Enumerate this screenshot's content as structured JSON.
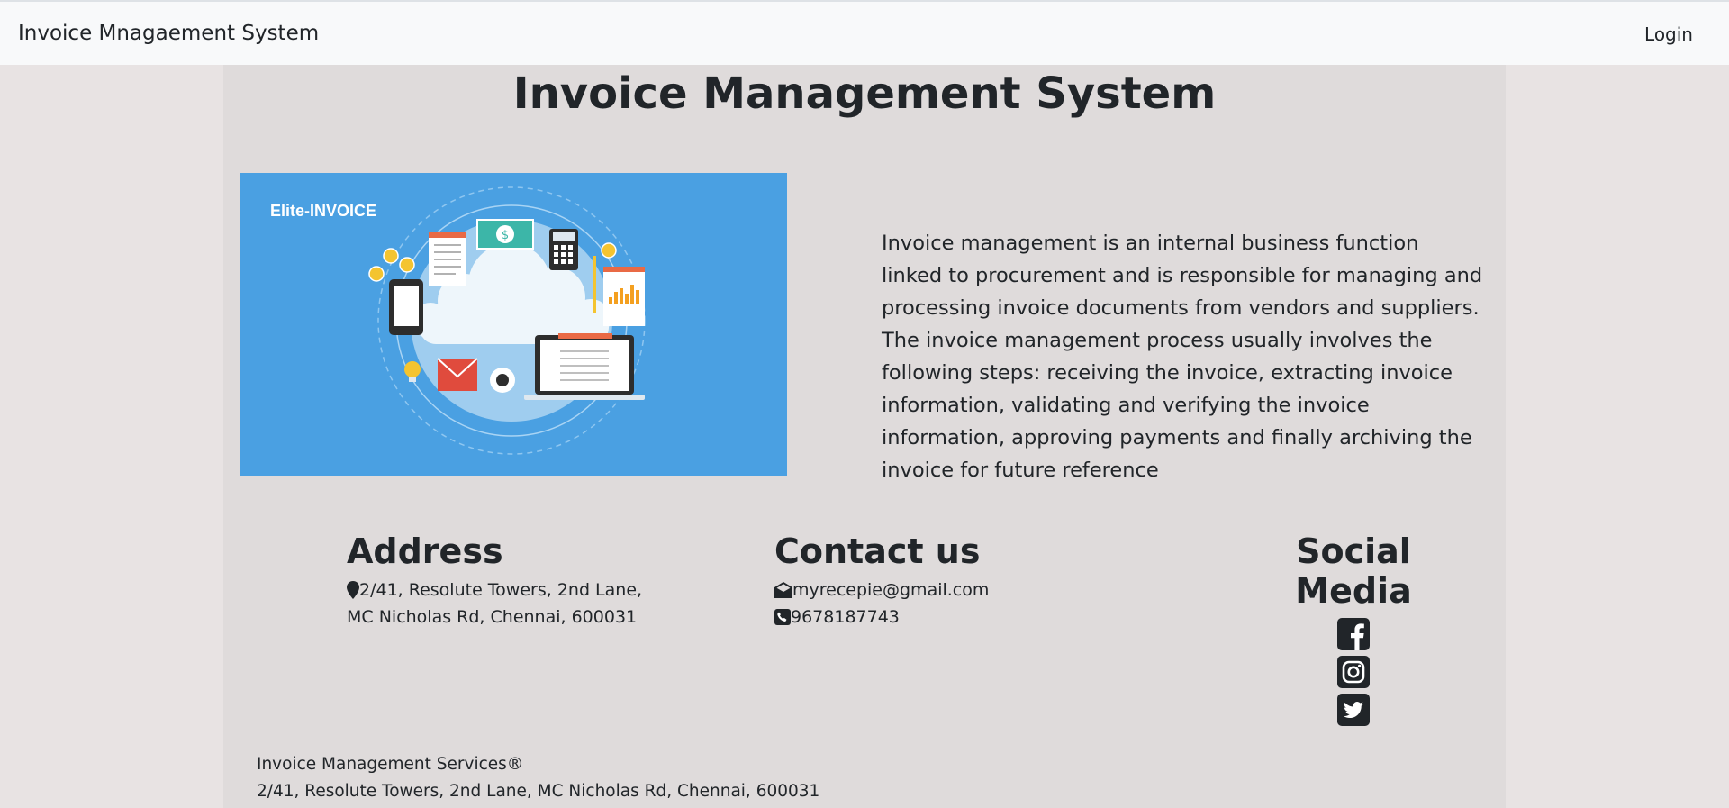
{
  "navbar": {
    "brand": "Invoice Mnagaement System",
    "login_label": "Login"
  },
  "main": {
    "title": "Invoice Management System",
    "hero_label": "Elite-INVOICE",
    "description": "Invoice management is an internal business function linked to procurement and is responsible for managing and processing invoice documents from vendors and suppliers. The invoice management process usually involves the following steps: receiving the invoice, extracting invoice information, validating and verifying the invoice information, approving payments and finally archiving the invoice for future reference"
  },
  "address": {
    "heading": "Address",
    "line1": "2/41, Resolute Towers, 2nd Lane,",
    "line2": "MC Nicholas Rd, Chennai, 600031",
    "icon": "map-pin-icon"
  },
  "contact": {
    "heading": "Contact us",
    "email": "myrecepie@gmail.com",
    "phone": "9678187743",
    "email_icon": "envelope-icon",
    "phone_icon": "phone-icon"
  },
  "social": {
    "heading": "Social Media",
    "items": [
      "facebook-icon",
      "instagram-icon",
      "twitter-icon"
    ]
  },
  "footer": {
    "company": "Invoice Management Services®",
    "address": "2/41, Resolute Towers, 2nd Lane, MC Nicholas Rd, Chennai, 600031"
  },
  "colors": {
    "page_bg": "#e8e3e3",
    "container_bg": "#dfdbdb",
    "navbar_bg": "#f8f9fa",
    "hero_bg": "#4aa0e2",
    "text": "#212529"
  }
}
